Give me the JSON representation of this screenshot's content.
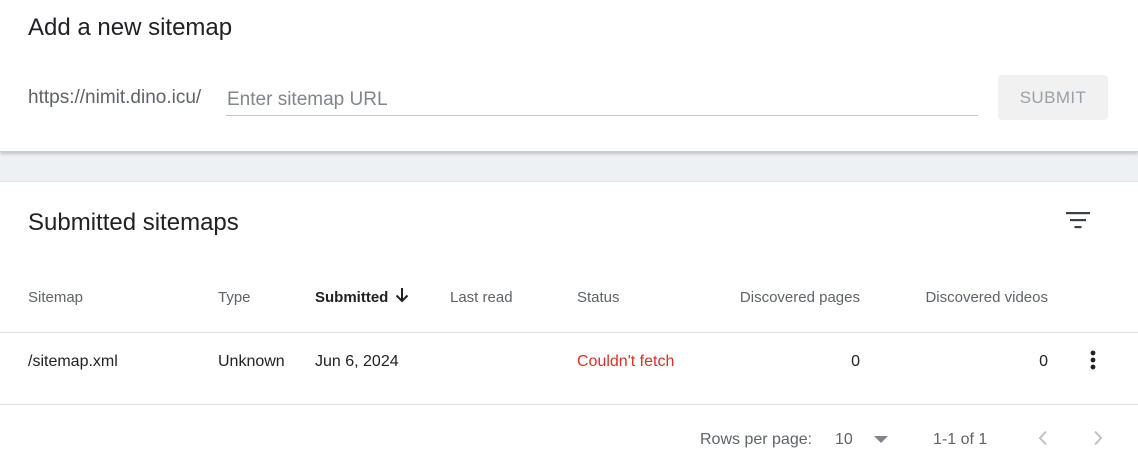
{
  "add_sitemap": {
    "title": "Add a new sitemap",
    "url_prefix": "https://nimit.dino.icu/",
    "input_value": "",
    "input_placeholder": "Enter sitemap URL",
    "submit_label": "SUBMIT"
  },
  "submitted": {
    "title": "Submitted sitemaps",
    "filter_icon": "filter-icon",
    "columns": {
      "sitemap": "Sitemap",
      "type": "Type",
      "submitted": "Submitted",
      "last_read": "Last read",
      "status": "Status",
      "discovered_pages": "Discovered pages",
      "discovered_videos": "Discovered videos"
    },
    "sort_icon": "arrow-down-icon",
    "rows": [
      {
        "sitemap": "/sitemap.xml",
        "type": "Unknown",
        "submitted": "Jun 6, 2024",
        "last_read": "",
        "status": "Couldn't fetch",
        "discovered_pages": "0",
        "discovered_videos": "0"
      }
    ],
    "status_error_color": "#d93025"
  },
  "pagination": {
    "rows_per_page_label": "Rows per page:",
    "rows_per_page_value": "10",
    "range": "1-1 of 1"
  }
}
